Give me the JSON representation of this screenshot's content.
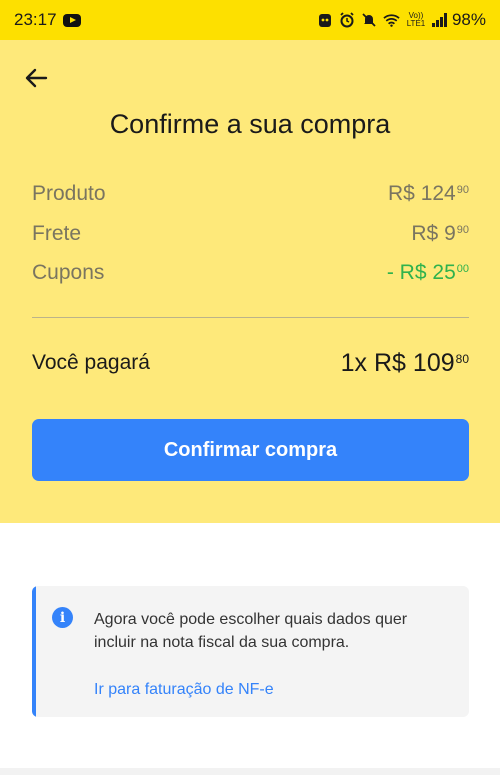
{
  "status_bar": {
    "time": "23:17",
    "battery": "98%",
    "volte": "Vo)) LTE1",
    "icons": [
      "youtube-icon",
      "app-icon",
      "alarm-icon",
      "mute-icon",
      "wifi-icon",
      "volte-icon",
      "signal-icon"
    ]
  },
  "header": {
    "title": "Confirme a sua compra"
  },
  "summary": {
    "product": {
      "label": "Produto",
      "currency": "R$",
      "whole": "124",
      "cents": "90"
    },
    "shipping": {
      "label": "Frete",
      "currency": "R$",
      "whole": "9",
      "cents": "90"
    },
    "coupons": {
      "label": "Cupons",
      "prefix": "- R$",
      "whole": "25",
      "cents": "00"
    }
  },
  "total": {
    "label": "Você pagará",
    "installments": "1x",
    "currency": "R$",
    "whole": "109",
    "cents": "80"
  },
  "actions": {
    "confirm_label": "Confirmar compra"
  },
  "info": {
    "text": "Agora você pode escolher quais dados quer incluir na nota fiscal da sua compra.",
    "link": "Ir para faturação de NF-e"
  },
  "colors": {
    "status_bar": "#fde000",
    "header_bg": "#fee97a",
    "primary": "#3483fa",
    "discount": "#2fb24d"
  }
}
